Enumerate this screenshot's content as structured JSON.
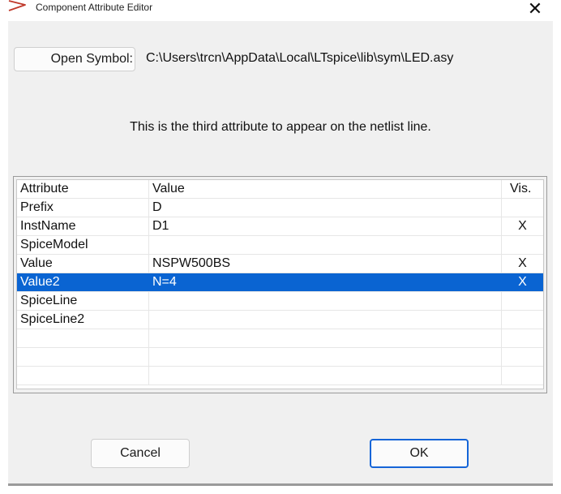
{
  "window": {
    "title": "Component Attribute Editor",
    "close_glyph": "✕",
    "app_icon": "ltspice-triangle-icon"
  },
  "symbol": {
    "open_button_label": "Open Symbol:",
    "path": "C:\\Users\\trcn\\AppData\\Local\\LTspice\\lib\\sym\\LED.asy"
  },
  "description": "This is the third attribute to appear on the netlist line.",
  "table": {
    "headers": {
      "attribute": "Attribute",
      "value": "Value",
      "vis": "Vis."
    },
    "rows": [
      {
        "attribute": "Prefix",
        "value": "D",
        "vis": ""
      },
      {
        "attribute": "InstName",
        "value": "D1",
        "vis": "X"
      },
      {
        "attribute": "SpiceModel",
        "value": "",
        "vis": ""
      },
      {
        "attribute": "Value",
        "value": "NSPW500BS",
        "vis": "X"
      },
      {
        "attribute": "Value2",
        "value": "N=4",
        "vis": "X",
        "selected": true
      },
      {
        "attribute": "SpiceLine",
        "value": "",
        "vis": ""
      },
      {
        "attribute": "SpiceLine2",
        "value": "",
        "vis": ""
      },
      {
        "attribute": "",
        "value": "",
        "vis": ""
      },
      {
        "attribute": "",
        "value": "",
        "vis": ""
      },
      {
        "attribute": "",
        "value": "",
        "vis": ""
      }
    ]
  },
  "buttons": {
    "cancel": "Cancel",
    "ok": "OK"
  },
  "colors": {
    "selection": "#0a64d2",
    "ok_border": "#1565d8",
    "dialog_bg": "#f0f0f0",
    "icon_red": "#c0392b"
  }
}
